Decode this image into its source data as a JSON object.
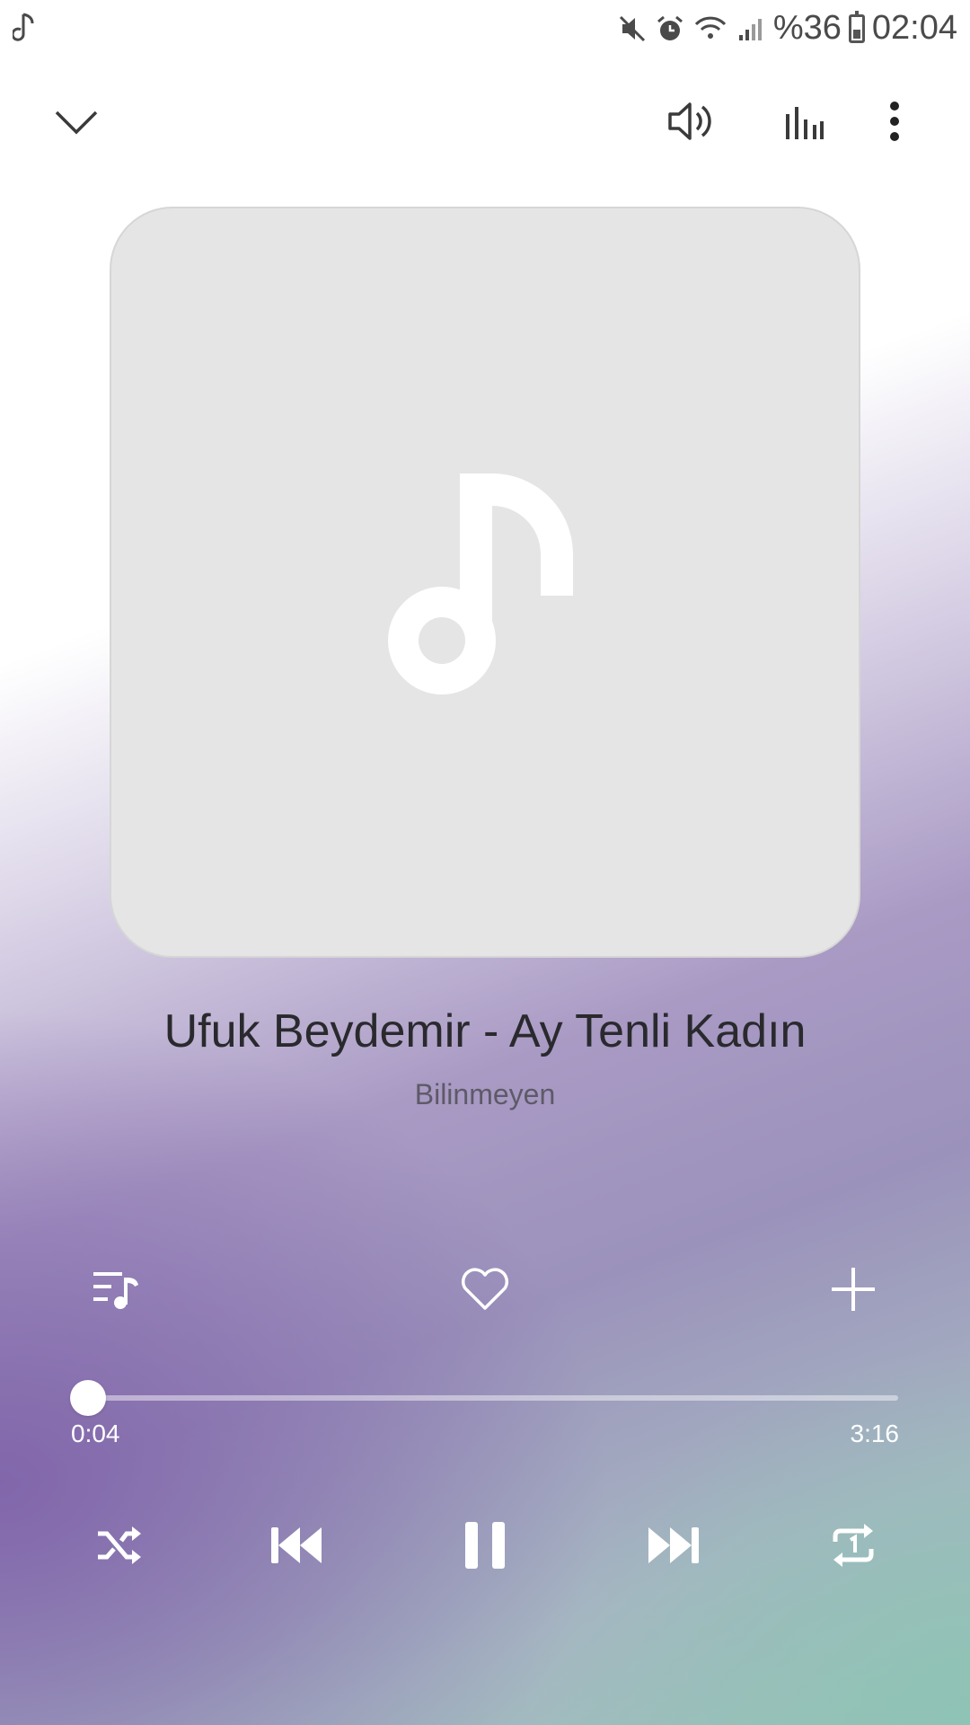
{
  "status_bar": {
    "battery": "%36",
    "time": "02:04"
  },
  "track": {
    "title": "Ufuk Beydemir - Ay Tenli Kadın",
    "artist": "Bilinmeyen"
  },
  "playback": {
    "elapsed": "0:04",
    "duration": "3:16",
    "progress_fraction": 0.02,
    "state": "playing"
  },
  "icons": {
    "status": [
      "music-note-icon",
      "mute-icon",
      "alarm-icon",
      "wifi-icon",
      "signal-icon",
      "battery-icon"
    ],
    "top_bar": [
      "chevron-down-icon",
      "volume-icon",
      "equalizer-icon",
      "more-icon"
    ],
    "actions": [
      "playlist-icon",
      "heart-icon",
      "plus-icon"
    ],
    "controls": [
      "shuffle-icon",
      "previous-icon",
      "pause-icon",
      "next-icon",
      "repeat-one-icon"
    ]
  },
  "colors": {
    "accent": "#ffffff",
    "text_primary": "#2a2a2e",
    "text_secondary": "#5e5a68",
    "gradient_purple": "#8b7ab0",
    "gradient_teal": "#9bc3b9"
  }
}
